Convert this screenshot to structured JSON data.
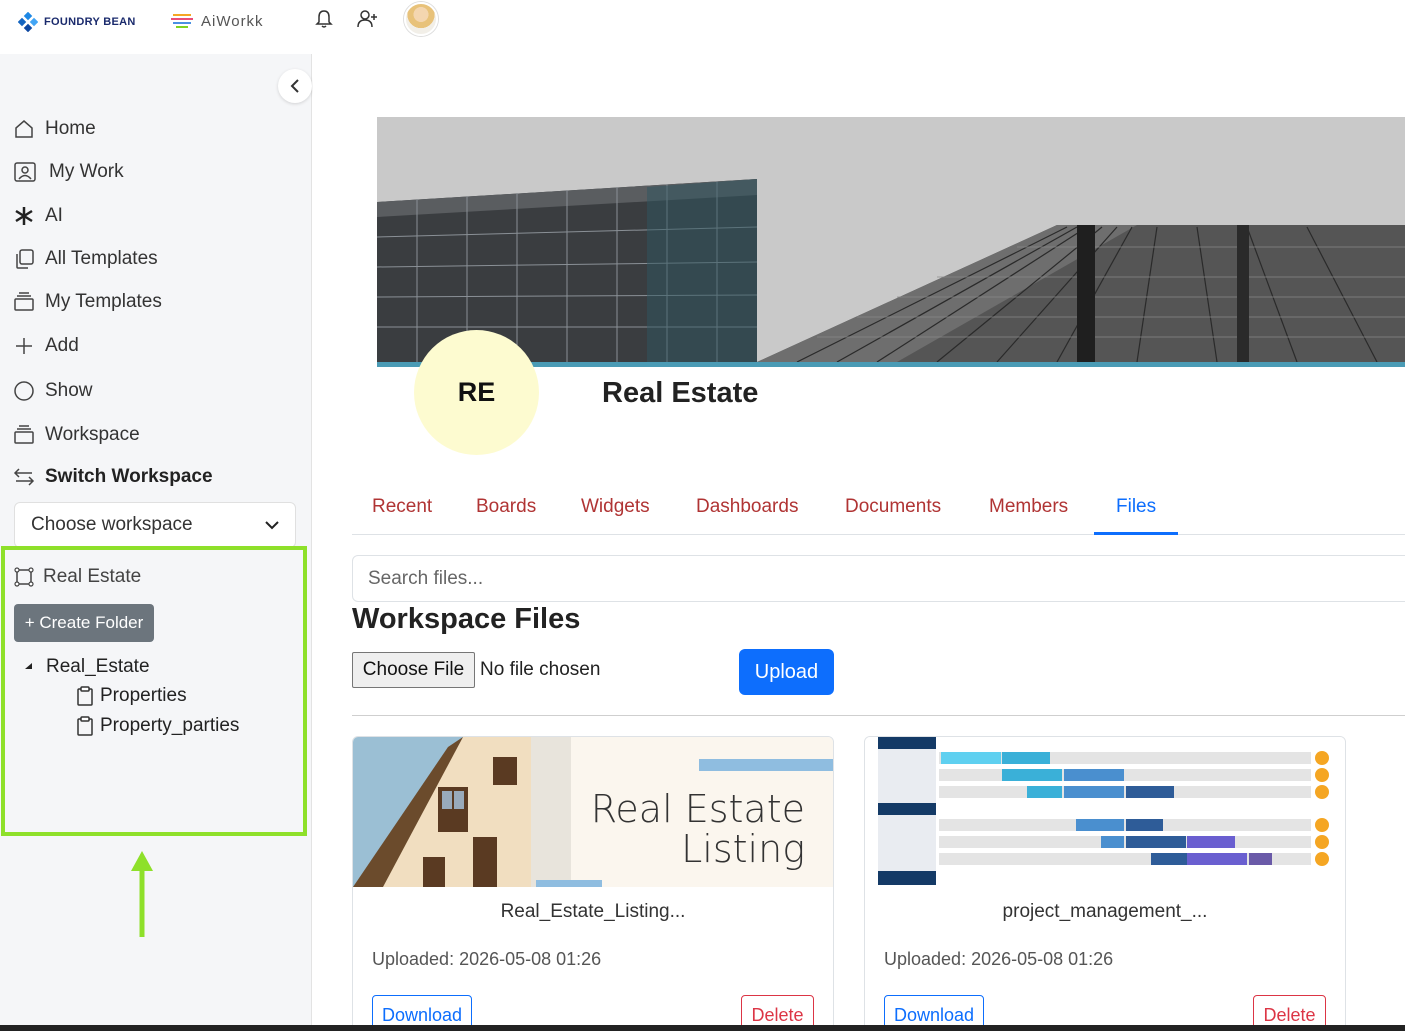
{
  "topbar": {
    "brand1": "FOUNDRY BEAN",
    "brand2": "AiWorkk",
    "icons": [
      "bell-icon",
      "add-user-icon",
      "avatar"
    ]
  },
  "sidebar": {
    "nav": [
      {
        "label": "Home",
        "icon": "home-icon"
      },
      {
        "label": "My Work",
        "icon": "user-card-icon"
      },
      {
        "label": "AI",
        "icon": "asterisk-icon"
      },
      {
        "label": "All Templates",
        "icon": "copy-icon"
      },
      {
        "label": "My Templates",
        "icon": "stack-icon"
      },
      {
        "label": "Add",
        "icon": "plus-icon"
      },
      {
        "label": "Show",
        "icon": "circle-icon"
      },
      {
        "label": "Workspace",
        "icon": "stack-icon"
      },
      {
        "label": "Switch Workspace",
        "icon": "switch-arrows-icon"
      }
    ],
    "workspace_select": "Choose workspace",
    "workspace_name": "Real Estate",
    "create_folder": "+ Create Folder",
    "tree": {
      "root": "Real_Estate",
      "children": [
        "Properties",
        "Property_parties"
      ]
    }
  },
  "main": {
    "workspace_initials": "RE",
    "workspace_title": "Real Estate",
    "tabs": [
      "Recent",
      "Boards",
      "Widgets",
      "Dashboards",
      "Documents",
      "Members",
      "Files"
    ],
    "active_tab": "Files",
    "search_placeholder": "Search files...",
    "files_heading": "Workspace Files",
    "choose_file": "Choose File",
    "no_file": "No file chosen",
    "upload": "Upload",
    "files": [
      {
        "name": "Real_Estate_Listing...",
        "thumb_text_1": "Real Estate",
        "thumb_text_2": "Listing",
        "uploaded": "Uploaded: 2026-05-08 01:26",
        "download": "Download",
        "delete": "Delete"
      },
      {
        "name": "project_management_...",
        "uploaded": "Uploaded: 2026-05-08 01:26",
        "download": "Download",
        "delete": "Delete"
      }
    ]
  },
  "colors": {
    "accent": "#0d6efd",
    "tab_text": "#b03434",
    "highlight": "#8ee02a",
    "avatar_bg": "#fdfbd0"
  }
}
